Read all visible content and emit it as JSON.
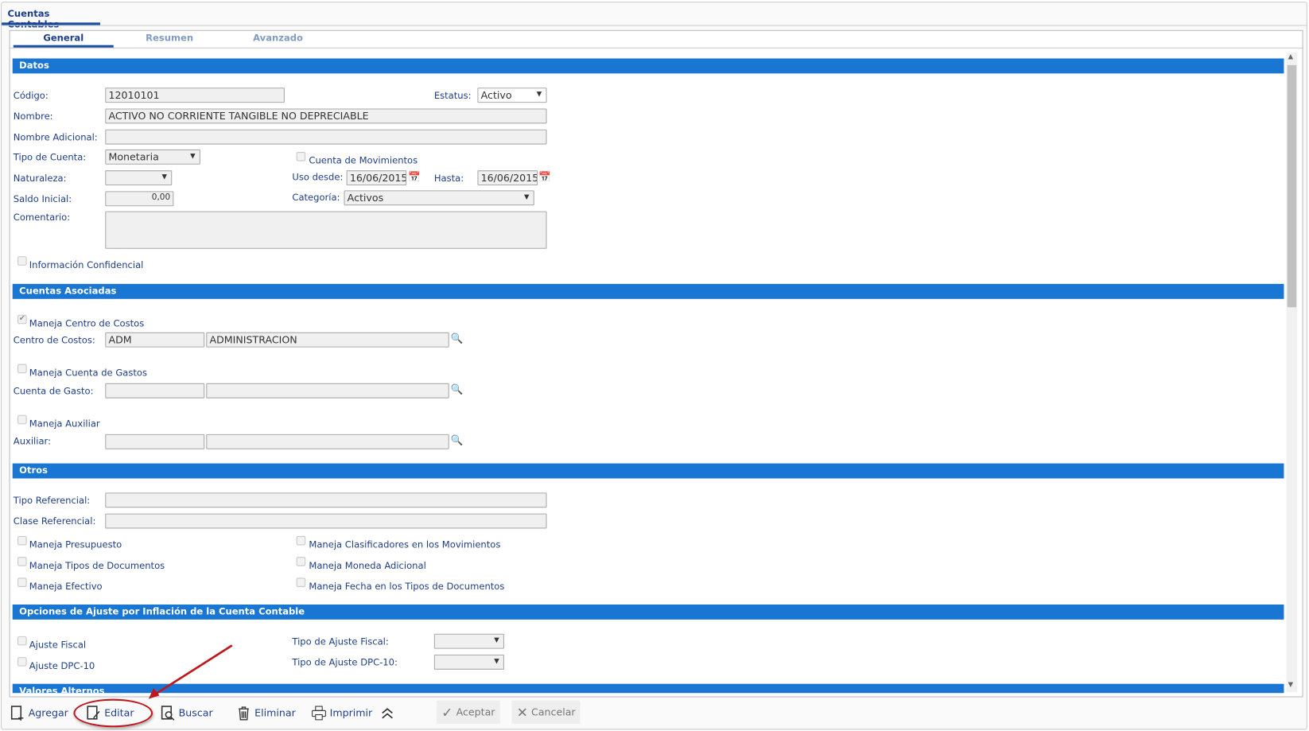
{
  "window": {
    "tab": "Cuentas Contables"
  },
  "tabs": [
    {
      "label": "General",
      "active": true
    },
    {
      "label": "Resumen"
    },
    {
      "label": "Avanzado"
    }
  ],
  "sections": {
    "datos": "Datos",
    "cuentas": "Cuentas Asociadas",
    "otros": "Otros",
    "ajuste": "Opciones de Ajuste por Inflación de la Cuenta Contable",
    "valores": "Valores Alternos"
  },
  "datos": {
    "codigo_label": "Código:",
    "codigo": "12010101",
    "estatus_label": "Estatus:",
    "estatus": "Activo",
    "nombre_label": "Nombre:",
    "nombre": "ACTIVO NO CORRIENTE TANGIBLE NO DEPRECIABLE",
    "nombre_adic_label": "Nombre Adicional:",
    "nombre_adic": "",
    "tipo_label": "Tipo de Cuenta:",
    "tipo": "Monetaria",
    "movimientos_label": "Cuenta de Movimientos",
    "naturaleza_label": "Naturaleza:",
    "naturaleza": "",
    "uso_desde_label": "Uso desde:",
    "uso_desde": "16/06/2015",
    "hasta_label": "Hasta:",
    "hasta": "16/06/2015",
    "saldo_label": "Saldo Inicial:",
    "saldo": "0,00",
    "categoria_label": "Categoría:",
    "categoria": "Activos",
    "comentario_label": "Comentario:",
    "confidencial_label": "Información Confidencial"
  },
  "cuentas": {
    "maneja_cc": "Maneja Centro de Costos",
    "cc_label": "Centro de Costos:",
    "cc_code": "ADM",
    "cc_name": "ADMINISTRACION",
    "maneja_gastos": "Maneja Cuenta de Gastos",
    "gasto_label": "Cuenta de Gasto:",
    "maneja_aux": "Maneja Auxiliar",
    "aux_label": "Auxiliar:"
  },
  "otros": {
    "tipo_ref_label": "Tipo Referencial:",
    "clase_ref_label": "Clase Referencial:",
    "checks": [
      "Maneja Presupuesto",
      "Maneja Tipos de Documentos",
      "Maneja Efectivo",
      "Maneja Clasificadores en los Movimientos",
      "Maneja Moneda Adicional",
      "Maneja Fecha en los Tipos de Documentos"
    ]
  },
  "ajuste": {
    "fiscal": "Ajuste Fiscal",
    "dpc": "Ajuste DPC-10",
    "tipo_fiscal_label": "Tipo de Ajuste Fiscal:",
    "tipo_dpc_label": "Tipo de Ajuste DPC-10:"
  },
  "toolbar": {
    "agregar": "Agregar",
    "editar": "Editar",
    "buscar": "Buscar",
    "eliminar": "Eliminar",
    "imprimir": "Imprimir",
    "aceptar": "Aceptar",
    "cancelar": "Cancelar"
  },
  "colors": {
    "section": "#1976d2",
    "label": "#1f3f86",
    "annotation": "#c0161c"
  }
}
